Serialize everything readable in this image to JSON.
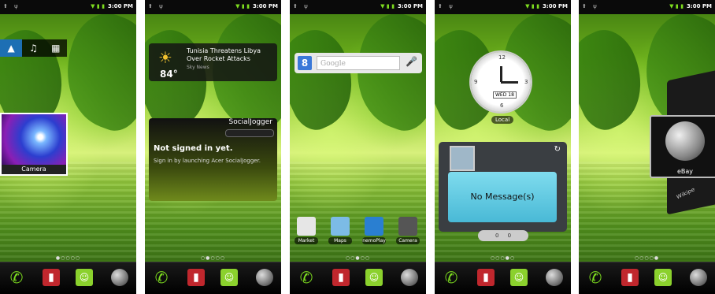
{
  "status_time": "3:00 PM",
  "screens": [
    {
      "id": "photo-widget",
      "tabs": [
        "▲",
        "♫",
        "▦"
      ],
      "photo_caption": "Camera",
      "dots": "●○○○○"
    },
    {
      "id": "news-social",
      "weather_temp": "84°",
      "news_headline": "Tunisia Threatens Libya Over Rocket Attacks",
      "news_source": "Sky News",
      "social_title": "SocialJogger",
      "social_heading": "Not signed in yet.",
      "social_text": "Sign in by launching Acer SocialJogger.",
      "dots": "○●○○○"
    },
    {
      "id": "google-apps",
      "search_placeholder": "Google",
      "apps": [
        "Market",
        "Maps",
        "nemoPlay",
        "Camera"
      ],
      "dots": "○○●○○"
    },
    {
      "id": "clock-messages",
      "clock_date": "WED 18",
      "clock_label": "Local",
      "message_text": "No Message(s)",
      "pill_counts": [
        "0",
        "0"
      ],
      "dots": "○○○●○"
    },
    {
      "id": "cube",
      "cube_label": "eBay",
      "back_label": "Wikipe",
      "dots": "○○○○●"
    }
  ],
  "dock": [
    "phone-icon",
    "contacts-icon",
    "messages-icon",
    "browser-icon"
  ],
  "colors": {
    "accent_green": "#7ddc1f",
    "status_bg": "#0a0a0a",
    "bubble": "#5cc6e0"
  }
}
